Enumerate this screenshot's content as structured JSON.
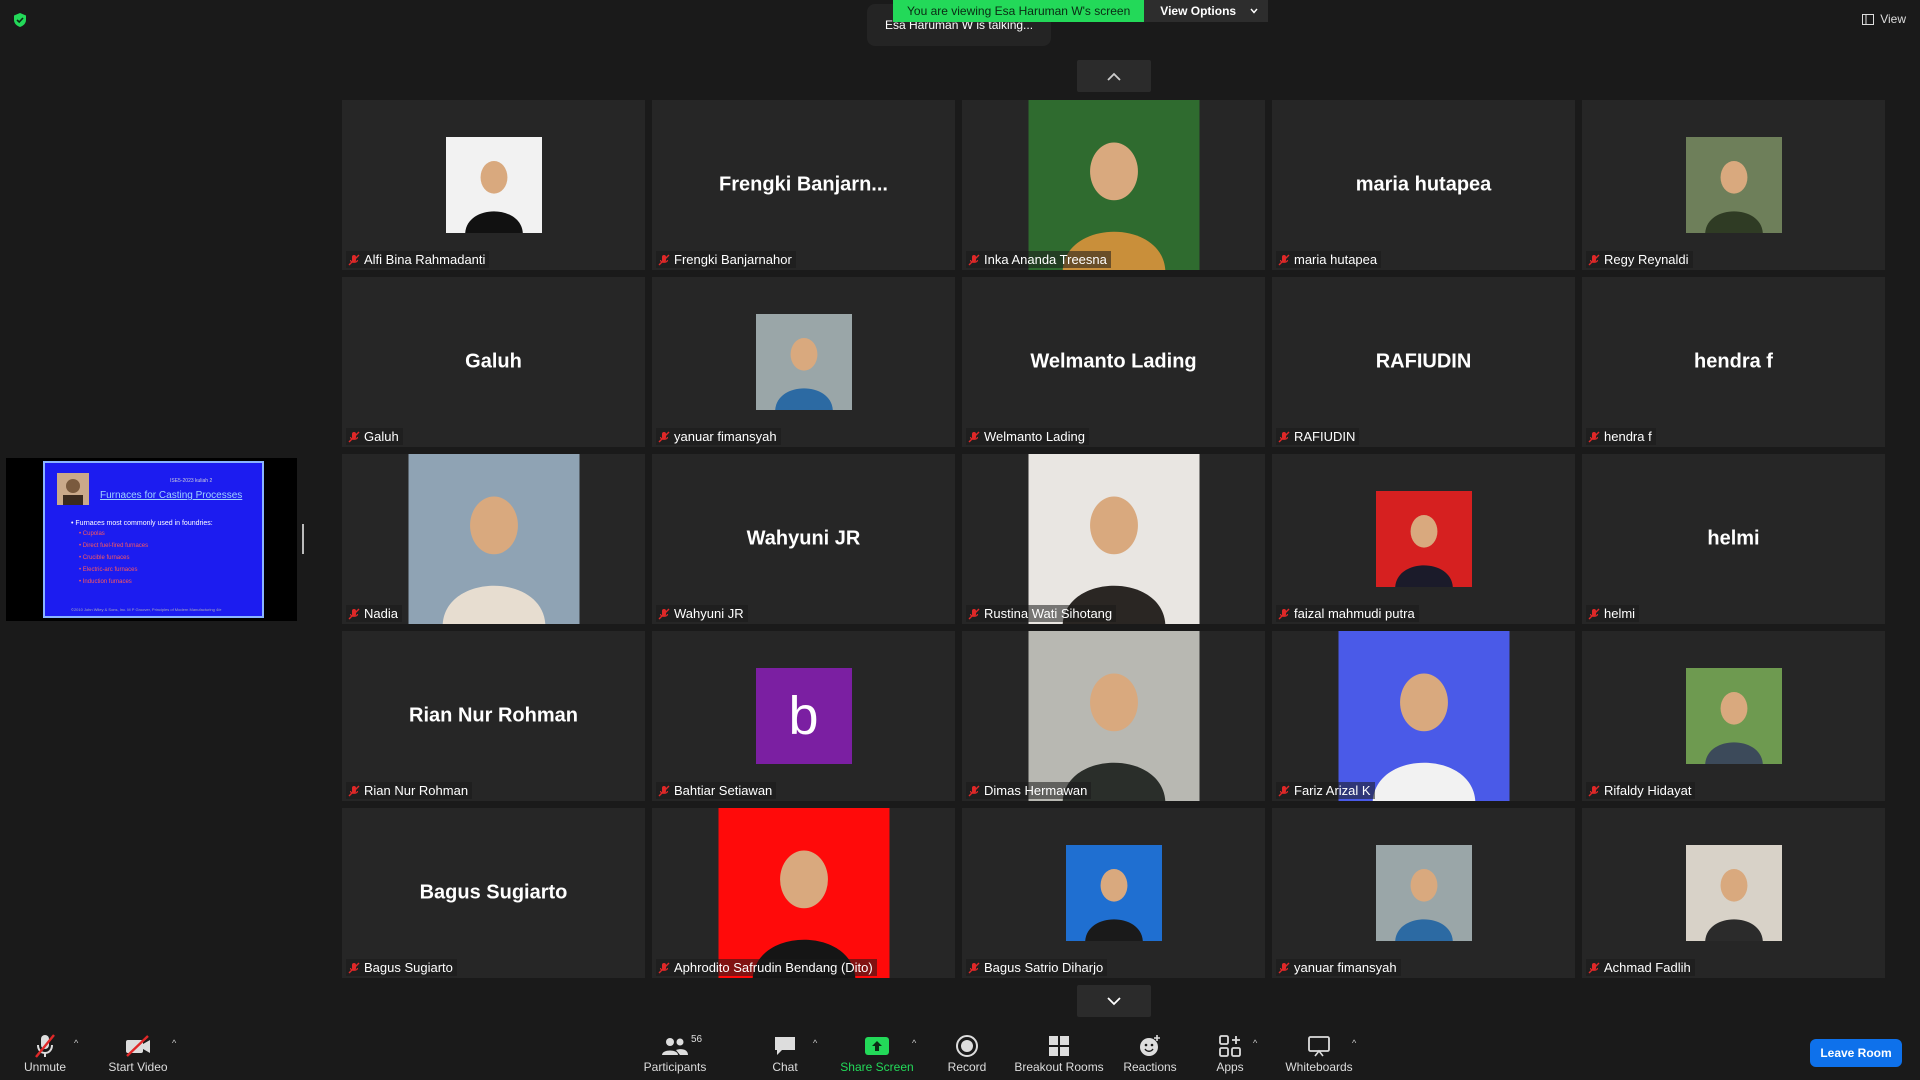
{
  "header": {
    "banner_text": "You are viewing Esa Haruman W's screen",
    "view_options_label": "View Options",
    "talking_text": "Esa Haruman W is talking...",
    "view_label": "View"
  },
  "shared_screen": {
    "slide_subtitle": "ISE5-2023 kuliah 2",
    "slide_title": "Furnaces for Casting Processes",
    "slide_heading": "• Furnaces most commonly used in foundries:",
    "slide_bullets": [
      "• Cupolas",
      "• Direct fuel-fired furnaces",
      "• Crucible furnaces",
      "• Electric-arc furnaces",
      "• Induction furnaces"
    ],
    "slide_footer": "©2010 John Wiley & Sons, Inc. M P Groover, Principles of Modern Manufacturing 4/e"
  },
  "participants": [
    {
      "name": "Alfi Bina Rahmadanti",
      "display": "photo"
    },
    {
      "name": "Frengki Banjarnahor",
      "display": "name",
      "big": "Frengki  Banjarn..."
    },
    {
      "name": "Inka Ananda Treesna",
      "display": "photo"
    },
    {
      "name": "maria hutapea",
      "display": "name",
      "big": "maria hutapea"
    },
    {
      "name": "Regy Reynaldi",
      "display": "photo"
    },
    {
      "name": "Galuh",
      "display": "name",
      "big": "Galuh"
    },
    {
      "name": "yanuar fimansyah",
      "display": "photo"
    },
    {
      "name": "Welmanto Lading",
      "display": "name",
      "big": "Welmanto Lading"
    },
    {
      "name": "RAFIUDIN",
      "display": "name",
      "big": "RAFIUDIN"
    },
    {
      "name": "hendra f",
      "display": "name",
      "big": "hendra f"
    },
    {
      "name": "Nadia",
      "display": "photo"
    },
    {
      "name": "Wahyuni JR",
      "display": "name",
      "big": "Wahyuni JR"
    },
    {
      "name": "Rustina Wati Sihotang",
      "display": "photo"
    },
    {
      "name": "faizal mahmudi putra",
      "display": "photo"
    },
    {
      "name": "helmi",
      "display": "name",
      "big": "helmi"
    },
    {
      "name": "Rian Nur Rohman",
      "display": "name",
      "big": "Rian Nur Rohman"
    },
    {
      "name": "Bahtiar Setiawan",
      "display": "avatar",
      "letter": "b"
    },
    {
      "name": "Dimas Hermawan",
      "display": "photo"
    },
    {
      "name": "Fariz Arizal K",
      "display": "photo"
    },
    {
      "name": "Rifaldy Hidayat",
      "display": "photo"
    },
    {
      "name": "Bagus Sugiarto",
      "display": "name",
      "big": "Bagus Sugiarto"
    },
    {
      "name": "Aphrodito Safrudin Bendang (Dito)",
      "display": "photo"
    },
    {
      "name": "Bagus Satrio Diharjo",
      "display": "photo"
    },
    {
      "name": "yanuar fimansyah",
      "display": "photo"
    },
    {
      "name": "Achmad Fadlih",
      "display": "photo"
    }
  ],
  "toolbar": {
    "unmute": "Unmute",
    "start_video": "Start Video",
    "participants": "Participants",
    "participants_count": "56",
    "chat": "Chat",
    "share_screen": "Share Screen",
    "record": "Record",
    "breakout_rooms": "Breakout Rooms",
    "reactions": "Reactions",
    "apps": "Apps",
    "whiteboards": "Whiteboards",
    "leave": "Leave Room"
  },
  "colors": {
    "accent_green": "#23d959",
    "leave_blue": "#0e71eb",
    "mute_red": "#e02828",
    "avatar_purple": "#7b1fa2"
  }
}
